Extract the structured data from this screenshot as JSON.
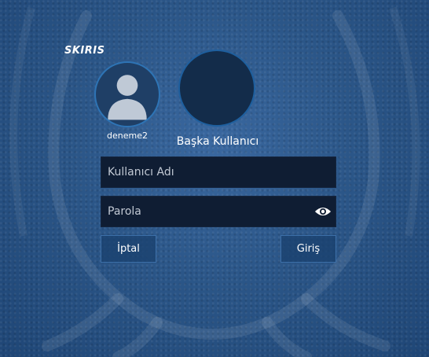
{
  "brand": {
    "title": "SKIRIS"
  },
  "users": [
    {
      "name": "deneme2",
      "icon": "person-silhouette-icon"
    },
    {
      "name": "Başka Kullanıcı",
      "icon": ""
    }
  ],
  "login_form": {
    "username_placeholder": "Kullanıcı Adı",
    "username_value": "",
    "password_placeholder": "Parola",
    "password_value": "",
    "show_password_icon": "eye-icon"
  },
  "actions": {
    "cancel_label": "İptal",
    "login_label": "Giriş"
  },
  "colors": {
    "background": "#2a5486",
    "field_background": "#0f1d33",
    "button_border": "#3c6fa8",
    "avatar_ring": "#2e74b5"
  }
}
